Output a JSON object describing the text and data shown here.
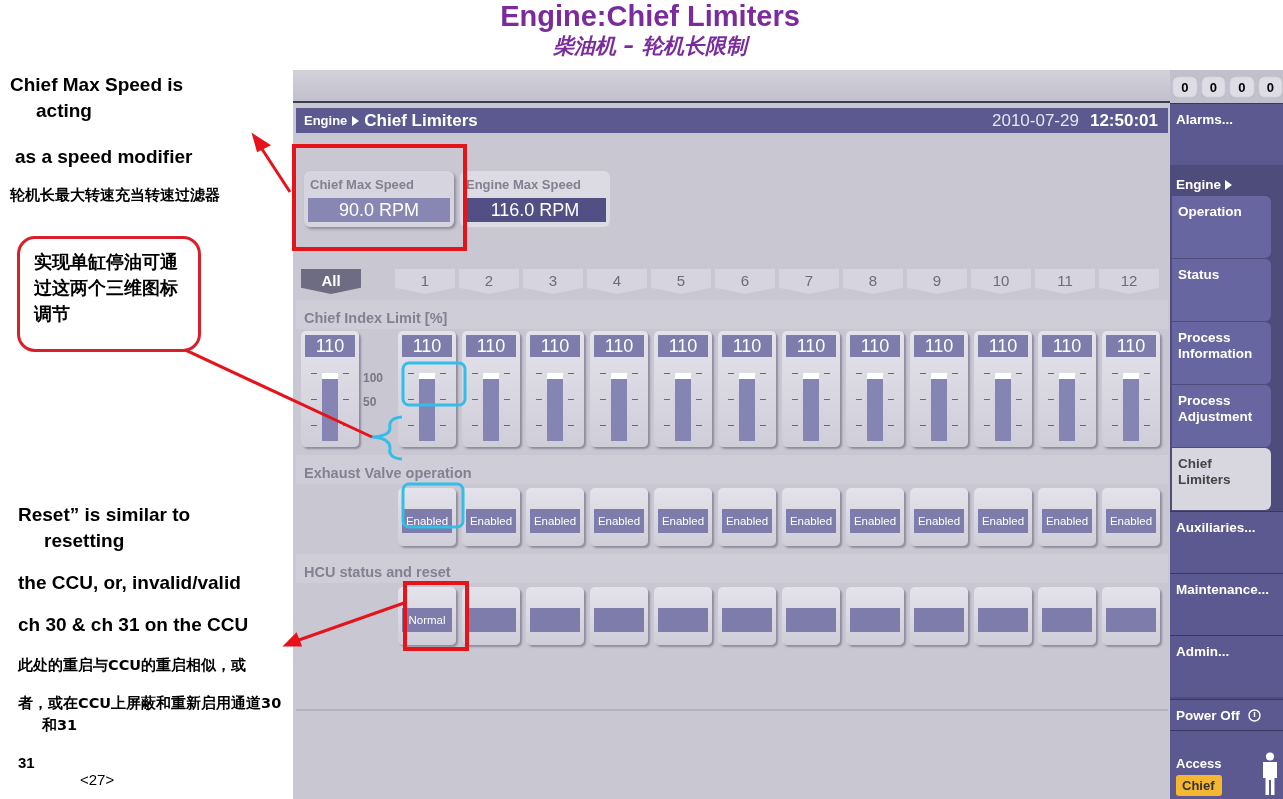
{
  "slide": {
    "title": "Engine:Chief Limiters",
    "subtitle": "柴油机 – 轮机长限制",
    "notes": [
      {
        "kind": "heading",
        "text": "Chief Max Speed is acting"
      },
      {
        "kind": "heading",
        "text": "as a speed modifier"
      },
      {
        "kind": "small",
        "text": "轮机长最大转速充当转速过滤器"
      },
      {
        "kind": "callout",
        "text": "实现单缸停油可通过这两个三维图标调节"
      },
      {
        "kind": "heading",
        "text": "Reset” is similar to resetting"
      },
      {
        "kind": "heading",
        "text": "the CCU, or, invalid/valid"
      },
      {
        "kind": "heading",
        "text": "ch 30 & ch 31 on the CCU"
      },
      {
        "kind": "small",
        "text": "此处的重启与CCU的重启相似，或"
      },
      {
        "kind": "small",
        "text": "者，或在CCU上屏蔽和重新启用通道30和31"
      },
      {
        "kind": "footer",
        "text": "31"
      },
      {
        "kind": "page",
        "text": "<27>"
      }
    ]
  },
  "screen": {
    "counters": [
      "0",
      "0",
      "0",
      "0"
    ],
    "header": {
      "breadcrumb": "Engine",
      "title": "Chief Limiters",
      "date": "2010-07-29",
      "time": "12:50:01"
    },
    "speeds": [
      {
        "label": "Chief Max Speed",
        "value": "90.0  RPM",
        "selected": true
      },
      {
        "label": "Engine Max Speed",
        "value": "116.0 RPM",
        "selected": false
      }
    ],
    "tabs": [
      {
        "label": "All",
        "selected": true
      },
      {
        "label": "1",
        "selected": false
      },
      {
        "label": "2",
        "selected": false
      },
      {
        "label": "3",
        "selected": false
      },
      {
        "label": "4",
        "selected": false
      },
      {
        "label": "5",
        "selected": false
      },
      {
        "label": "6",
        "selected": false
      },
      {
        "label": "7",
        "selected": false
      },
      {
        "label": "8",
        "selected": false
      },
      {
        "label": "9",
        "selected": false
      },
      {
        "label": "10",
        "selected": false
      },
      {
        "label": "11",
        "selected": false
      },
      {
        "label": "12",
        "selected": false
      }
    ],
    "index_section": {
      "label": "Chief Index Limit [%]",
      "scale_labels": [
        "100",
        "50"
      ],
      "all": {
        "value": "110",
        "level": 1.0
      },
      "cylinders": [
        {
          "value": "110",
          "level": 1.0
        },
        {
          "value": "110",
          "level": 1.0
        },
        {
          "value": "110",
          "level": 1.0
        },
        {
          "value": "110",
          "level": 1.0
        },
        {
          "value": "110",
          "level": 1.0
        },
        {
          "value": "110",
          "level": 1.0
        },
        {
          "value": "110",
          "level": 1.0
        },
        {
          "value": "110",
          "level": 1.0
        },
        {
          "value": "110",
          "level": 1.0
        },
        {
          "value": "110",
          "level": 1.0
        },
        {
          "value": "110",
          "level": 1.0
        },
        {
          "value": "110",
          "level": 1.0
        }
      ]
    },
    "valve_section": {
      "label": "Exhaust Valve operation",
      "buttons": [
        "Enabled",
        "Enabled",
        "Enabled",
        "Enabled",
        "Enabled",
        "Enabled",
        "Enabled",
        "Enabled",
        "Enabled",
        "Enabled",
        "Enabled",
        "Enabled"
      ]
    },
    "hcu_section": {
      "label": "HCU status and reset",
      "buttons": [
        {
          "kind": "status",
          "text": "Normal"
        },
        {
          "kind": "blank"
        },
        {
          "kind": "blank"
        },
        {
          "kind": "blank"
        },
        {
          "kind": "blank"
        },
        {
          "kind": "blank"
        },
        {
          "kind": "blank"
        },
        {
          "kind": "blank"
        },
        {
          "kind": "blank"
        },
        {
          "kind": "blank"
        },
        {
          "kind": "blank"
        },
        {
          "kind": "blank"
        }
      ]
    },
    "nav": [
      {
        "kind": "item",
        "label": "Alarms...",
        "selected": false
      },
      {
        "kind": "header",
        "label": "Engine",
        "children": [
          {
            "label": "Operation",
            "selected": false
          },
          {
            "label": "Status",
            "selected": false
          },
          {
            "label": "Process Information",
            "selected": false
          },
          {
            "label": "Process Adjustment",
            "selected": false
          },
          {
            "label": "Chief Limiters",
            "selected": true
          }
        ]
      },
      {
        "kind": "item",
        "label": "Auxiliaries...",
        "selected": false
      },
      {
        "kind": "item",
        "label": "Maintenance...",
        "selected": false
      },
      {
        "kind": "item",
        "label": "Admin...",
        "selected": false
      },
      {
        "kind": "power",
        "label": "Power Off"
      },
      {
        "kind": "access",
        "label": "Access",
        "badge": "Chief"
      }
    ]
  }
}
